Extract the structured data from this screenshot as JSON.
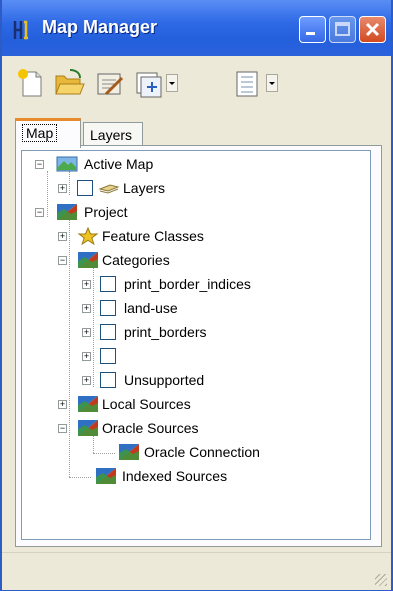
{
  "window": {
    "title": "Map Manager"
  },
  "toolbar": {
    "tools": [
      {
        "name": "new-icon"
      },
      {
        "name": "open-icon"
      },
      {
        "name": "properties-icon"
      },
      {
        "name": "add-icon"
      },
      {
        "name": "list-icon"
      }
    ]
  },
  "tabs": [
    {
      "label": "Map",
      "selected": true
    },
    {
      "label": "Layers",
      "selected": false
    }
  ],
  "tree": {
    "active_map": {
      "label": "Active Map",
      "layers_label": "Layers"
    },
    "project": {
      "label": "Project",
      "feature_classes": "Feature Classes",
      "categories": {
        "label": "Categories",
        "items": [
          "print_border_indices",
          "land-use",
          "print_borders",
          "",
          "Unsupported"
        ]
      },
      "local_sources": "Local Sources",
      "oracle_sources": {
        "label": "Oracle Sources",
        "connection": "Oracle Connection"
      },
      "indexed_sources": "Indexed Sources"
    }
  },
  "colors": {
    "title_bar": "#245fdc",
    "tab_highlight": "#e68b2c",
    "window_bg": "#ece9d8",
    "close_button": "#d24a1f"
  }
}
